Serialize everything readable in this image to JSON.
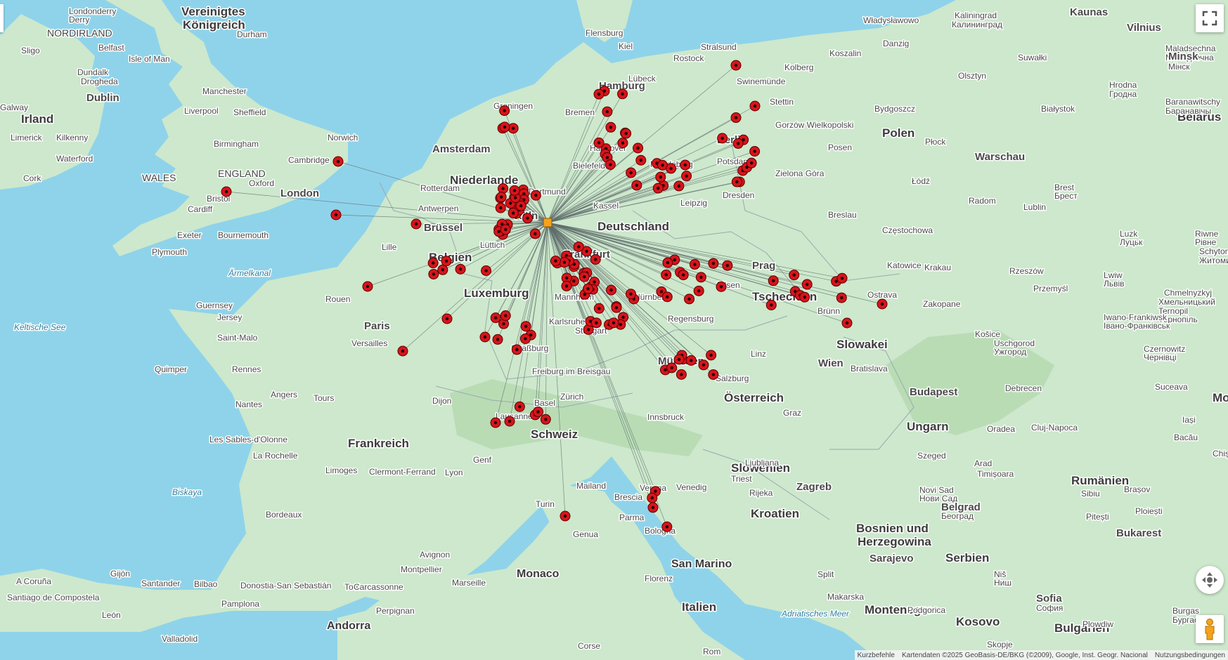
{
  "map": {
    "hub_color": "#f5a21b",
    "marker_color": "#d7141a",
    "land_color": "#cde8cc",
    "water_color": "#8fd3ea",
    "country_labels": [
      "Vereinigtes Königreich",
      "Irland",
      "Niederlande",
      "Belgien",
      "Luxemburg",
      "Deutschland",
      "Frankreich",
      "Schweiz",
      "Österreich",
      "Tschechien",
      "Polen",
      "Slowakei",
      "Ungarn",
      "Slowenien",
      "Kroatien",
      "Bosnien und Herzegowina",
      "Serbien",
      "Rumänien",
      "Bulgarien",
      "Kosovo",
      "Montenegro",
      "Italien",
      "Monaco",
      "San Marino",
      "Andorra",
      "Belarus",
      "Moldau"
    ],
    "region_labels": [
      "NORDIRLAND",
      "ENGLAND",
      "WALES"
    ],
    "sea_labels": [
      "Keltische See",
      "Ärmelkanal",
      "Biskaya",
      "Adriatisches Meer"
    ],
    "city_labels": [
      "Londonderry",
      "Derry",
      "Belfast",
      "Sligo",
      "Dundalk",
      "Drogheda",
      "Isle of Man",
      "Dublin",
      "Galway",
      "Limerick",
      "Kilkenny",
      "Waterford",
      "Cork",
      "Manchester",
      "Liverpool",
      "Sheffield",
      "Durham",
      "Birmingham",
      "Norwich",
      "Cambridge",
      "Oxford",
      "London",
      "Bristol",
      "Cardiff",
      "Exeter",
      "Bournemouth",
      "Plymouth",
      "Guernsey",
      "Jersey",
      "Brest",
      "Quimper",
      "Saint-Malo",
      "Rouen",
      "Paris",
      "Versailles",
      "Rennes",
      "Angers",
      "Tours",
      "Nantes",
      "Les Sables-d'Olonne",
      "La Rochelle",
      "Limoges",
      "Clermont-Ferrand",
      "Lyon",
      "Genf",
      "Dijon",
      "Bordeaux",
      "Toulouse",
      "Montpellier",
      "Avignon",
      "Marseille",
      "Carcassonne",
      "Perpignan",
      "Pamplona",
      "Donostia-San Sebastián",
      "Bilbao",
      "Santander",
      "Gijón",
      "A Coruña",
      "Santiago de Compostela",
      "León",
      "Valladolid",
      "Amsterdam",
      "Rotterdam",
      "Antwerpen",
      "Brüssel",
      "Lille",
      "Lüttich",
      "Groningen",
      "Bremen",
      "Hamburg",
      "Bielefeld",
      "Hannover",
      "Magdeburg",
      "Kassel",
      "Leipzig",
      "Dresden",
      "Berlin",
      "Potsdam",
      "Rostock",
      "Lübeck",
      "Kiel",
      "Flensburg",
      "Stralsund",
      "Swinemünde",
      "Stettin",
      "Köln",
      "Dortmund",
      "Frankfurt",
      "Mannheim",
      "Karlsruhe",
      "Stuttgart",
      "Nürnberg",
      "Regensburg",
      "München",
      "Straßburg",
      "Freiburg im Breisgau",
      "Basel",
      "Zürich",
      "Lausanne",
      "Innsbruck",
      "Salzburg",
      "Linz",
      "Wien",
      "Graz",
      "Bratislava",
      "Brünn",
      "Prag",
      "Pilsen",
      "Ostrava",
      "Katowice",
      "Krakau",
      "Breslau",
      "Posen",
      "Zielona Góra",
      "Gorzów Wielkopolski",
      "Koszalin",
      "Kolberg",
      "Danzig",
      "Bydgoszcz",
      "Olsztyn",
      "Płock",
      "Łódź",
      "Warschau",
      "Radom",
      "Lublin",
      "Częstochowa",
      "Rzeszów",
      "Przemyśl",
      "Zakopane",
      "Kaliningrad",
      "Калининград",
      "Władysławowo",
      "Kaunas",
      "Vilnius",
      "Suwałki",
      "Białystok",
      "Hrodna",
      "Гродна",
      "Maladsechna",
      "Маладзечна",
      "Minsk",
      "Мінск",
      "Baranawitschy",
      "Баранавічы",
      "Brest",
      "Брест",
      "Luzk",
      "Луцьк",
      "Riwne",
      "Рівне",
      "Lwiw",
      "Львів",
      "Ternopil",
      "Тернопіль",
      "Iwano-Frankiwsk",
      "Івано-Франківськ",
      "Chmelnyzkyj",
      "Хмельницький",
      "Schytomyr",
      "Житомир",
      "Czernowitz",
      "Чернівці",
      "Uschgorod",
      "Ужгород",
      "Košice",
      "Budapest",
      "Debrecen",
      "Szeged",
      "Oradea",
      "Cluj-Napoca",
      "Iași",
      "Suceava",
      "Bacău",
      "Chișinău",
      "Timișoara",
      "Arad",
      "Sibiu",
      "Brașov",
      "Pitești",
      "Ploiești",
      "Bukarest",
      "Novi Sad",
      "Нови Сад",
      "Belgrad",
      "Београд",
      "Zagreb",
      "Rijeka",
      "Triest",
      "Ljubljana",
      "Split",
      "Sarajevo",
      "Podgorica",
      "Skopje",
      "Sofia",
      "София",
      "Plowdiw",
      "Burgas",
      "Бургас",
      "Niš",
      "Ниш",
      "Makarska",
      "Turin",
      "Mailand",
      "Brescia",
      "Verona",
      "Venedig",
      "Parma",
      "Genua",
      "Bologna",
      "Florenz",
      "Rom",
      "Corse"
    ],
    "markers_count": 180
  },
  "controls": {
    "fullscreen_icon": "fullscreen-icon",
    "camera_icon": "camera-control-icon",
    "pegman_icon": "pegman-icon"
  },
  "attribution": {
    "shortcuts": "Kurzbefehle",
    "data": "Kartendaten ©2025 GeoBasis-DE/BKG (©2009), Google, Inst. Geogr. Nacional",
    "terms": "Nutzungsbedingungen"
  }
}
